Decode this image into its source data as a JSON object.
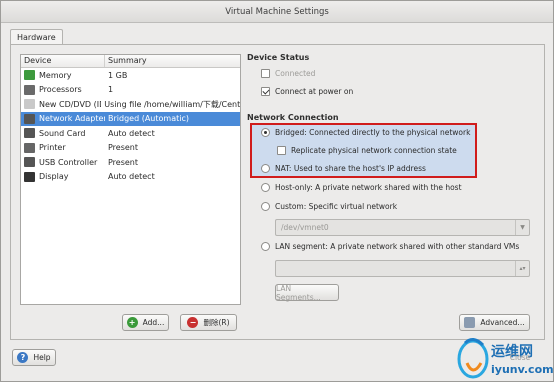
{
  "window": {
    "title": "Virtual Machine Settings"
  },
  "tabs": [
    "Hardware"
  ],
  "device_table": {
    "headers": [
      "Device",
      "Summary"
    ],
    "rows": [
      {
        "device": "Memory",
        "summary": "1 GB",
        "icon": "memory-icon",
        "color": "#3d9a3d"
      },
      {
        "device": "Processors",
        "summary": "1",
        "icon": "processor-icon",
        "color": "#6a6a6a"
      },
      {
        "device": "New CD/DVD (IDE)",
        "summary": "Using file /home/william/下载/CentO",
        "icon": "cdrom-icon",
        "color": "#c9c9c9"
      },
      {
        "device": "Network Adapter",
        "summary": "Bridged (Automatic)",
        "icon": "network-icon",
        "color": "#555555"
      },
      {
        "device": "Sound Card",
        "summary": "Auto detect",
        "icon": "sound-icon",
        "color": "#555555"
      },
      {
        "device": "Printer",
        "summary": "Present",
        "icon": "printer-icon",
        "color": "#666666"
      },
      {
        "device": "USB Controller",
        "summary": "Present",
        "icon": "usb-icon",
        "color": "#555555"
      },
      {
        "device": "Display",
        "summary": "Auto detect",
        "icon": "display-icon",
        "color": "#333333"
      }
    ],
    "selected_index": 3
  },
  "buttons": {
    "add": "Add...",
    "remove": "删除(R)",
    "advanced": "Advanced...",
    "help": "Help",
    "lan_segments": "LAN Segments..."
  },
  "device_status": {
    "title": "Device Status",
    "connected": "Connected",
    "connect_at_power_on": "Connect at power on"
  },
  "network_connection": {
    "title": "Network Connection",
    "bridged": "Bridged: Connected directly to the physical network",
    "replicate": "Replicate physical network connection state",
    "nat": "NAT: Used to share the host's IP address",
    "host_only": "Host-only: A private network shared with the host",
    "custom": "Custom: Specific virtual network",
    "custom_value": "/dev/vmnet0",
    "lan_segment": "LAN segment: A private network shared with other standard VMs"
  },
  "watermark": {
    "text": "运维网",
    "url_text": "iyunv.com",
    "close": "Close"
  },
  "colors": {
    "highlight_border": "#d01c1c",
    "selection": "#4a8ad8"
  }
}
